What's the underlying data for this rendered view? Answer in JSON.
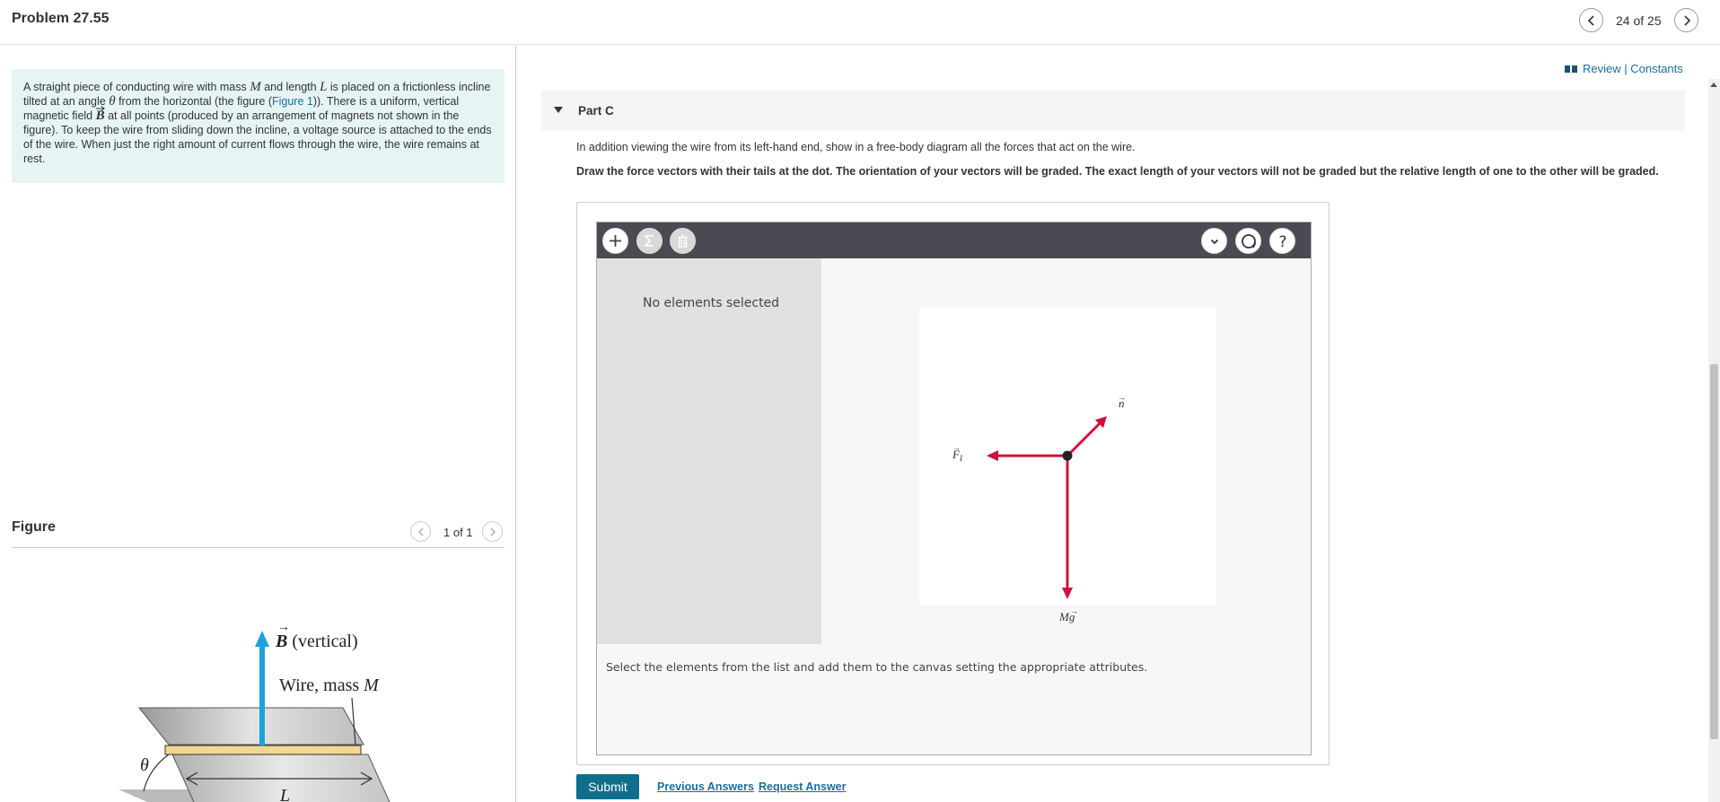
{
  "header": {
    "title": "Problem 27.55",
    "pager": "24 of 25"
  },
  "intro": {
    "t1": "A straight piece of conducting wire with mass ",
    "M": "M",
    "t2": " and length ",
    "L": "L",
    "t3": " is placed on a frictionless incline tilted at an angle ",
    "theta": "θ",
    "t4": " from the horizontal (the figure (",
    "figure_link": "Figure 1",
    "t5": ")). There is a uniform, vertical magnetic field ",
    "B": "B",
    "t6": " at all points (produced by an arrangement of magnets not shown in the figure). To keep the wire from sliding down the incline, a voltage source is attached to the ends of the wire. When just the right amount of current flows through the wire, the wire remains at rest."
  },
  "figure": {
    "title": "Figure",
    "pager": "1 of 1",
    "b_label": "B",
    "b_suffix": " (vertical)",
    "wire_label": "Wire, mass ",
    "wire_mass": "M",
    "theta_label": "θ",
    "length_label": "L"
  },
  "links": {
    "review": "Review",
    "separator": " | ",
    "constants": "Constants"
  },
  "part": {
    "label": "Part C",
    "instruction": "In addition viewing the wire from its left-hand end, show in a free-body diagram all the forces that act on the wire.",
    "bold_instruction": "Draw the force vectors with their tails at the dot. The orientation of your vectors will be graded. The exact length of your vectors will not be graded but the relative length of one to the other will be graded."
  },
  "tool": {
    "no_elements": "No elements selected",
    "status": "Select the elements from the list and add them to the canvas setting the appropriate attributes.",
    "vector_labels": {
      "n": "n",
      "fi": "F",
      "fi_sub": "I",
      "mg": "Mg"
    },
    "vector_color": "#d0103a"
  },
  "actions": {
    "submit": "Submit",
    "previous_answers": "Previous Answers",
    "request_answer": "Request Answer"
  },
  "colors": {
    "accent": "#0f6e8c",
    "link": "#1a6e9f",
    "intro_bg": "#e6f4f4",
    "field_arrow": "#1ba3d9"
  }
}
